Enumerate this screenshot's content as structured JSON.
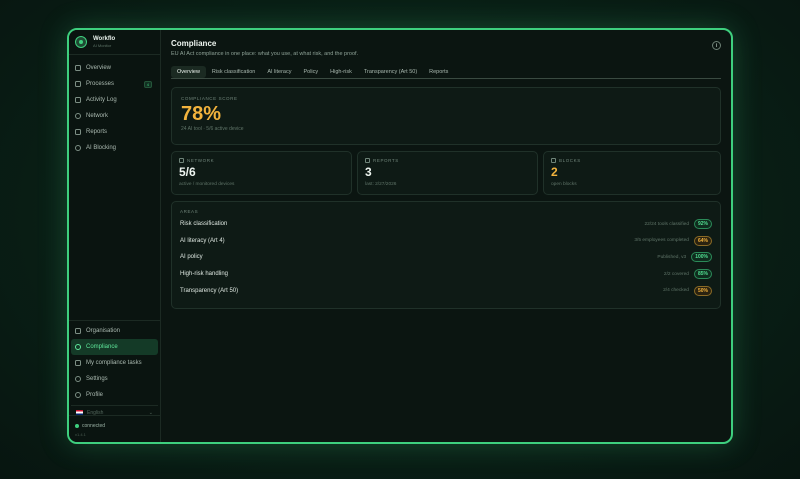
{
  "brand": {
    "name": "Workflo",
    "subtitle": "AI Monitor"
  },
  "sidebar": {
    "items": [
      {
        "label": "Overview",
        "icon": "grid-icon"
      },
      {
        "label": "Processes",
        "icon": "monitor-icon",
        "badge": "4"
      },
      {
        "label": "Activity Log",
        "icon": "list-icon"
      },
      {
        "label": "Network",
        "icon": "network-icon"
      },
      {
        "label": "Reports",
        "icon": "file-icon"
      },
      {
        "label": "AI Blocking",
        "icon": "shield-icon"
      }
    ],
    "bottom_items": [
      {
        "label": "Organisation",
        "icon": "building-icon"
      },
      {
        "label": "Compliance",
        "icon": "check-circle-icon",
        "active": true
      },
      {
        "label": "My compliance tasks",
        "icon": "clipboard-icon"
      },
      {
        "label": "Settings",
        "icon": "gear-icon"
      },
      {
        "label": "Profile",
        "icon": "user-icon"
      }
    ],
    "language": "English",
    "connection": {
      "status": "connected",
      "version": "v1.4.1"
    }
  },
  "header": {
    "title": "Compliance",
    "subtitle": "EU AI Act compliance in one place: what you use, at what risk, and the proof."
  },
  "tabs": [
    "Overview",
    "Risk classification",
    "AI literacy",
    "Policy",
    "High-risk",
    "Transparency (Art 50)",
    "Reports"
  ],
  "score": {
    "label": "Compliance score",
    "value": "78%",
    "meta": "24 AI tool · 5/6 active device"
  },
  "stats": [
    {
      "label": "Network",
      "value": "5/6",
      "meta": "active / monitored devices"
    },
    {
      "label": "Reports",
      "value": "3",
      "meta": "last: 2/27/2026"
    },
    {
      "label": "Blocks",
      "value": "2",
      "meta": "open blocks"
    }
  ],
  "areas": {
    "label": "Areas",
    "rows": [
      {
        "name": "Risk classification",
        "detail": "22/24 tools classified",
        "pct": "92%",
        "status": "green"
      },
      {
        "name": "AI literacy (Art 4)",
        "detail": "3/5 employees completed",
        "pct": "64%",
        "status": "amber"
      },
      {
        "name": "AI policy",
        "detail": "Published, v3",
        "pct": "100%",
        "status": "green"
      },
      {
        "name": "High-risk handling",
        "detail": "2/2 covered",
        "pct": "85%",
        "status": "green"
      },
      {
        "name": "Transparency (Art 50)",
        "detail": "2/4 checked",
        "pct": "50%",
        "status": "amber"
      }
    ]
  },
  "colors": {
    "accent": "#3ecf7e",
    "amber": "#f2b33d",
    "background": "#0b1511"
  }
}
